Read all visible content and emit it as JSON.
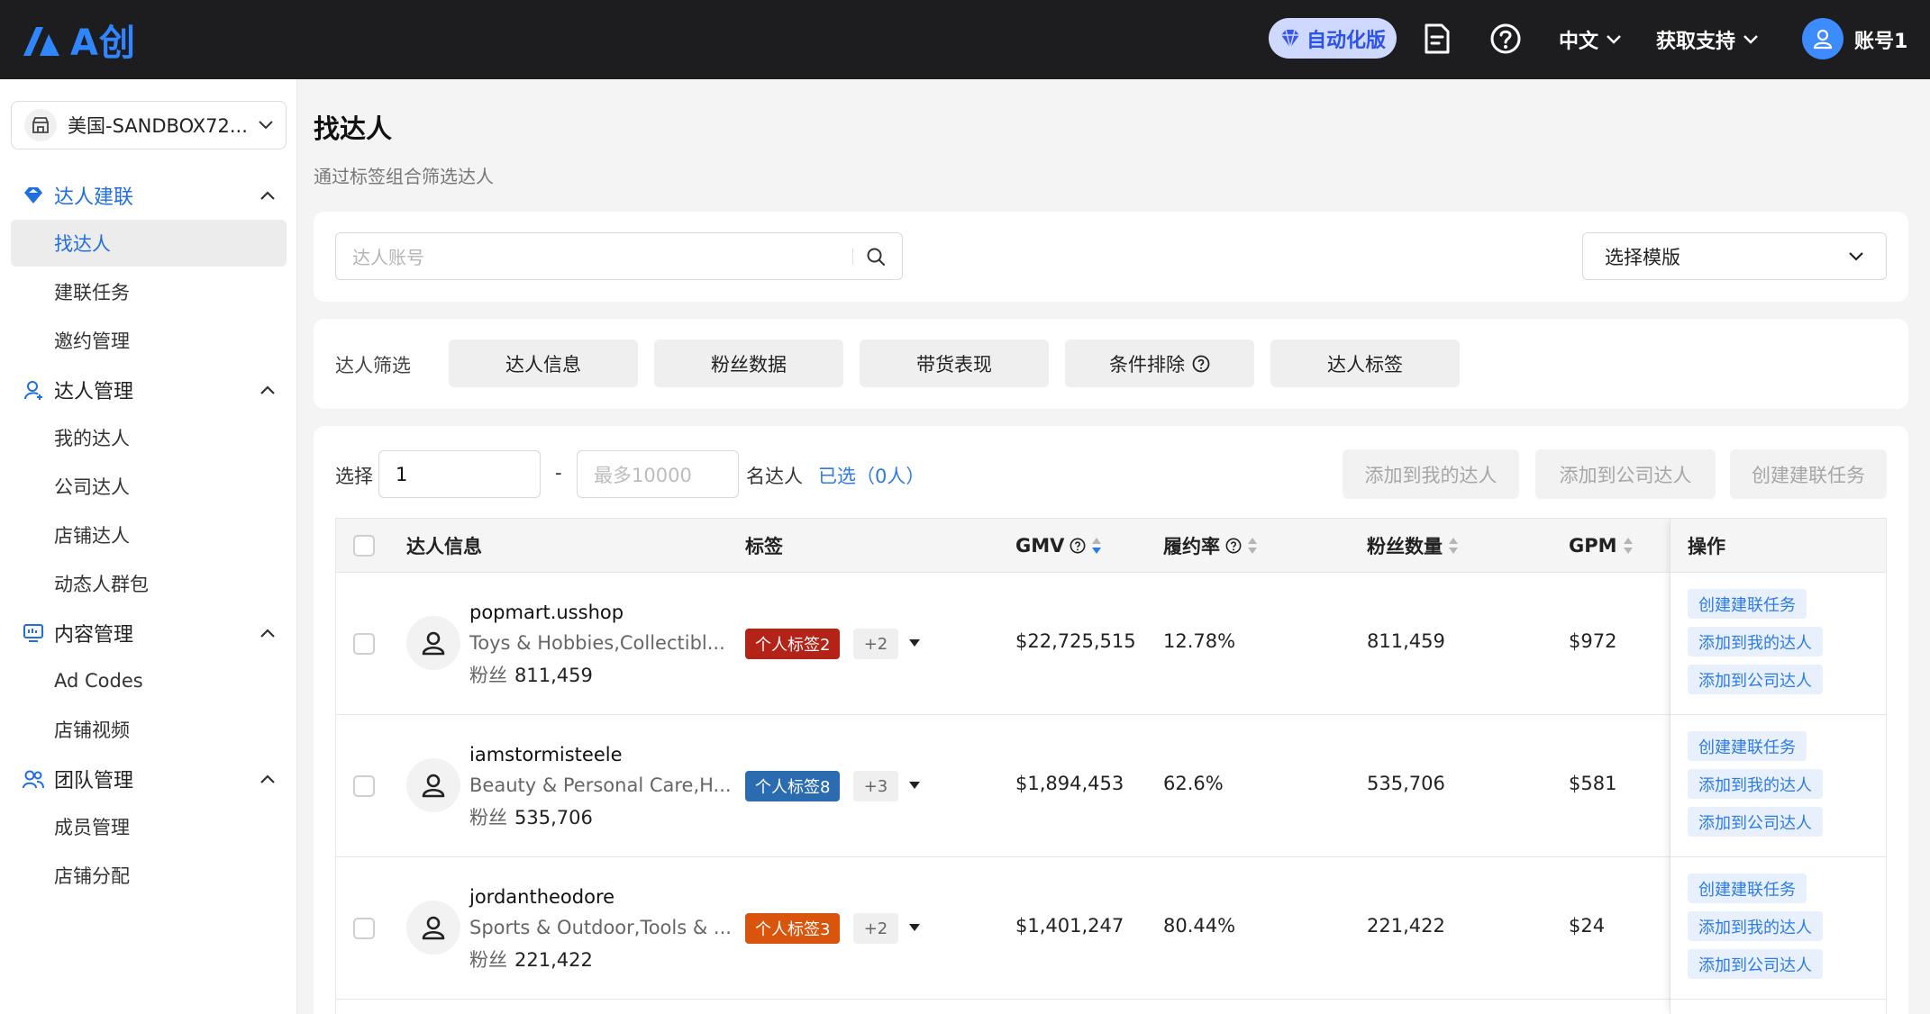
{
  "app": {
    "logo_text": "A创",
    "auto_badge": "自动化版",
    "language": "中文",
    "support": "获取支持",
    "account": "账号1"
  },
  "sidebar": {
    "store": "美国-SANDBOX72...",
    "groups": [
      {
        "label": "达人建联",
        "icon": "diamond-icon",
        "items": [
          "找达人",
          "建联任务",
          "邀约管理"
        ]
      },
      {
        "label": "达人管理",
        "icon": "user-icon",
        "items": [
          "我的达人",
          "公司达人",
          "店铺达人",
          "动态人群包"
        ]
      },
      {
        "label": "内容管理",
        "icon": "monitor-icon",
        "items": [
          "Ad Codes",
          "店铺视频"
        ]
      },
      {
        "label": "团队管理",
        "icon": "team-icon",
        "items": [
          "成员管理",
          "店铺分配"
        ]
      }
    ]
  },
  "page": {
    "title": "找达人",
    "subtitle": "通过标签组合筛选达人"
  },
  "search": {
    "placeholder": "达人账号",
    "template_select": "选择模版"
  },
  "filters": {
    "label": "达人筛选",
    "tabs": [
      "达人信息",
      "粉丝数据",
      "带货表现",
      "条件排除",
      "达人标签"
    ]
  },
  "selection": {
    "prefix": "选择",
    "from_value": "1",
    "to_placeholder": "最多10000",
    "dash": "-",
    "suffix": "名达人",
    "selected_link": "已选（0人）",
    "buttons": [
      "添加到我的达人",
      "添加到公司达人",
      "创建建联任务"
    ]
  },
  "table": {
    "headers": {
      "info": "达人信息",
      "tags": "标签",
      "gmv": "GMV",
      "fulfillment": "履约率",
      "fans": "粉丝数量",
      "gpm": "GPM",
      "ops": "操作"
    },
    "fans_prefix": "粉丝",
    "op_buttons": [
      "创建建联任务",
      "添加到我的达人",
      "添加到公司达人"
    ],
    "rows": [
      {
        "name": "popmart.usshop",
        "category": "Toys & Hobbies,Collectibl...",
        "fans": "811,459",
        "tag": "个人标签2",
        "tag_color": "#b42318",
        "more": "+2",
        "gmv": "$22,725,515",
        "fulfillment": "12.78%",
        "fans_count": "811,459",
        "gpm": "$972"
      },
      {
        "name": "iamstormisteele",
        "category": "Beauty & Personal Care,H...",
        "fans": "535,706",
        "tag": "个人标签8",
        "tag_color": "#2b6cb0",
        "more": "+3",
        "gmv": "$1,894,453",
        "fulfillment": "62.6%",
        "fans_count": "535,706",
        "gpm": "$581"
      },
      {
        "name": "jordantheodore",
        "category": "Sports & Outdoor,Tools & ...",
        "fans": "221,422",
        "tag": "个人标签3",
        "tag_color": "#d9540c",
        "more": "+2",
        "gmv": "$1,401,247",
        "fulfillment": "80.44%",
        "fans_count": "221,422",
        "gpm": "$24"
      }
    ]
  },
  "colors": {
    "accent": "#2c7be5",
    "topbar": "#1d1d1f"
  }
}
